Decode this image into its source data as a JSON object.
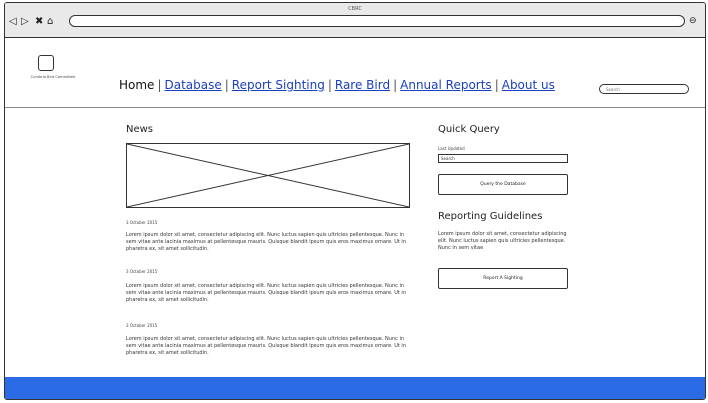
{
  "window": {
    "title": "CBRC",
    "nav_controls": [
      "◁",
      "▷",
      "✖",
      "⌂"
    ],
    "right_control": "⊖"
  },
  "site": {
    "logo_caption": "Cumbria Bird Committee",
    "nav": [
      {
        "label": "Home",
        "active": true
      },
      {
        "label": "Database",
        "active": false
      },
      {
        "label": "Report Sighting",
        "active": false
      },
      {
        "label": "Rare Bird",
        "active": false
      },
      {
        "label": "Annual Reports",
        "active": false
      },
      {
        "label": "About us",
        "active": false
      }
    ],
    "search_placeholder": "Search"
  },
  "news": {
    "title": "News",
    "items": [
      {
        "date": "3 October 2015",
        "text": "Lorem ipsum dolor sit amet, consectetur adipiscing elit. Nunc luctus sapien quis ultricies pellentesque. Nunc in sem vitae ante lacinia maximus at pellentesque mauris. Quisque blandit ipsum quis eros maximus ornare. Ut in pharetra ex, sit amet sollicitudin."
      },
      {
        "date": "3 October 2015",
        "text": "Lorem ipsum dolor sit amet, consectetur adipiscing elit. Nunc luctus sapien quis ultricies pellentesque. Nunc in sem vitae ante lacinia maximus at pellentesque mauris. Quisque blandit ipsum quis eros maximus ornare. Ut in pharetra ex, sit amet sollicitudin."
      },
      {
        "date": "3 October 2015",
        "text": "Lorem ipsum dolor sit amet, consectetur adipiscing elit. Nunc luctus sapien quis ultricies pellentesque. Nunc in sem vitae ante lacinia maximus at pellentesque mauris. Quisque blandit ipsum quis eros maximus ornare. Ut in pharetra ex, sit amet sollicitudin."
      }
    ]
  },
  "quick_query": {
    "title": "Quick Query",
    "field_label": "Last Updated",
    "field_value": "Search",
    "button_label": "Query the Database"
  },
  "guidelines": {
    "title": "Reporting Guidelines",
    "text": "Lorem ipsum dolor sit amet, consectetur adipiscing elit. Nunc luctus sapien quis ultricies pellentesque. Nunc in sem vitae",
    "button_label": "Report A Sighting"
  },
  "colors": {
    "footer": "#2c6be6",
    "link": "#1a3fbf"
  }
}
